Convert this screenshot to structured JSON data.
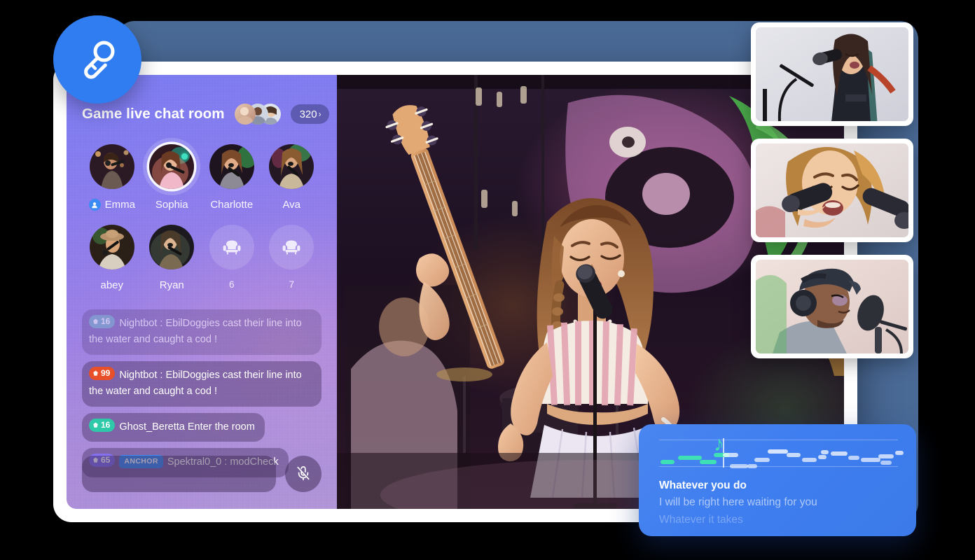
{
  "brand": {
    "logo_icon": "microphone-icon"
  },
  "room": {
    "title": "Game live chat room",
    "viewer_count": "320",
    "chevron": "›",
    "viewer_avatars": [
      "viewer-avatar-1",
      "viewer-avatar-2",
      "viewer-avatar-3"
    ]
  },
  "seats": [
    {
      "label": "Emma",
      "state": "occupied",
      "host": true,
      "speaking": false,
      "avatar": "avatar-emma"
    },
    {
      "label": "Sophia",
      "state": "occupied",
      "host": false,
      "speaking": true,
      "avatar": "avatar-sophia"
    },
    {
      "label": "Charlotte",
      "state": "occupied",
      "host": false,
      "speaking": false,
      "avatar": "avatar-charlotte"
    },
    {
      "label": "Ava",
      "state": "occupied",
      "host": false,
      "speaking": false,
      "avatar": "avatar-ava"
    },
    {
      "label": "abey",
      "state": "occupied",
      "host": false,
      "speaking": false,
      "avatar": "avatar-abey"
    },
    {
      "label": "Ryan",
      "state": "occupied",
      "host": false,
      "speaking": false,
      "avatar": "avatar-ryan"
    },
    {
      "label": "6",
      "state": "empty",
      "host": false,
      "speaking": false,
      "icon": "armchair-icon"
    },
    {
      "label": "7",
      "state": "empty",
      "host": false,
      "speaking": false,
      "icon": "armchair-icon"
    }
  ],
  "chat": {
    "messages": [
      {
        "level": "16",
        "level_color": "#6fa8bf",
        "tag": null,
        "text": "Nightbot : EbilDoggies cast their line into the water and caught a cod !",
        "faded": true,
        "wide": true
      },
      {
        "level": "99",
        "level_color": "#e8502a",
        "tag": null,
        "text": "Nightbot : EbilDoggies cast their line into the water and caught a cod !",
        "faded": false,
        "wide": true
      },
      {
        "level": "16",
        "level_color": "#2ec9a8",
        "tag": null,
        "text": "Ghost_Beretta Enter the room",
        "faded": false,
        "wide": false
      },
      {
        "level": "65",
        "level_color": "#8570ee",
        "tag": "ANCHOR",
        "text": "Spektral0_0 : modCheck",
        "faded": false,
        "wide": false
      }
    ],
    "gem_icon": "gem-icon"
  },
  "composer": {
    "value": "",
    "placeholder": "",
    "mic_icon": "microphone-muted-icon",
    "mic_state": "muted"
  },
  "stage": {
    "name": "live-stage-video",
    "caption": ""
  },
  "thumbnails": [
    {
      "name": "thumbnail-singer-1"
    },
    {
      "name": "thumbnail-singer-2"
    },
    {
      "name": "thumbnail-singer-3"
    }
  ],
  "lyrics": {
    "active": "Whatever you do",
    "next": "I will be right here waiting for you",
    "later": "Whatever it takes",
    "note_glyph": "♪",
    "sung_color": "#3ee0b4",
    "upcoming_color": "#ffffff"
  },
  "colors": {
    "brand_blue": "#2f7df0",
    "backdrop": "#4a6a96",
    "sidebar_start": "#7a7bf0",
    "sidebar_end": "#b094d6",
    "lyrics_card": "#4280ef",
    "anchor_badge": "#3d8bf5"
  }
}
